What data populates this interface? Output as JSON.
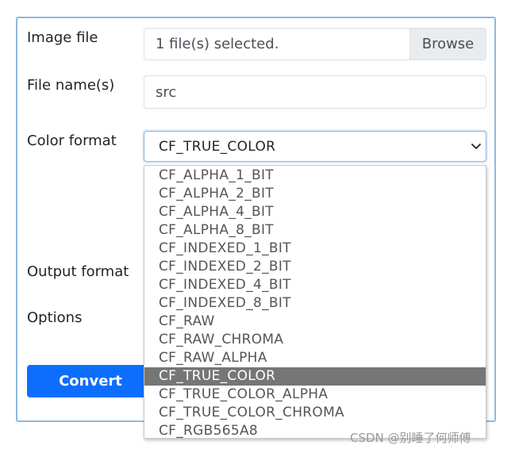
{
  "form": {
    "image_file_label": "Image file",
    "file_selected_text": "1 file(s) selected.",
    "browse_label": "Browse",
    "file_name_label": "File name(s)",
    "file_name_value": "src",
    "color_format_label": "Color format",
    "color_format_selected": "CF_TRUE_COLOR",
    "output_format_label": "Output format",
    "options_label": "Options",
    "convert_label": "Convert"
  },
  "color_format_options": [
    "CF_ALPHA_1_BIT",
    "CF_ALPHA_2_BIT",
    "CF_ALPHA_4_BIT",
    "CF_ALPHA_8_BIT",
    "CF_INDEXED_1_BIT",
    "CF_INDEXED_2_BIT",
    "CF_INDEXED_4_BIT",
    "CF_INDEXED_8_BIT",
    "CF_RAW",
    "CF_RAW_CHROMA",
    "CF_RAW_ALPHA",
    "CF_TRUE_COLOR",
    "CF_TRUE_COLOR_ALPHA",
    "CF_TRUE_COLOR_CHROMA",
    "CF_RGB565A8"
  ],
  "highlighted_option_index": 11,
  "watermark": "CSDN @别睡了何师傅",
  "colors": {
    "accent": "#0d6efd",
    "card_border": "#8fb9dd",
    "highlight": "#767676"
  },
  "icons": {
    "select_arrow": "chevron-down-icon"
  }
}
